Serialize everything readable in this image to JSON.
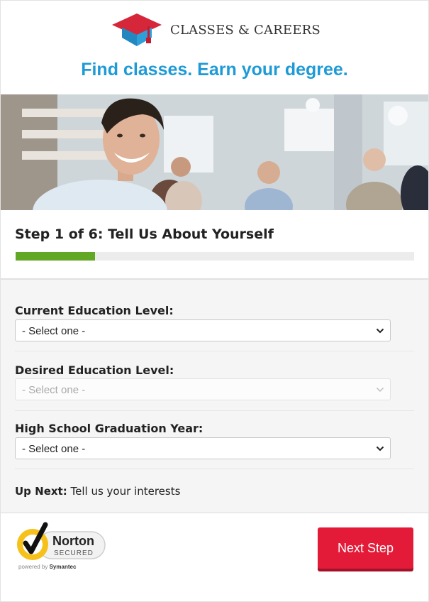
{
  "header": {
    "brand_name": "CLASSES & CAREERS",
    "tagline": "Find classes. Earn your degree."
  },
  "step": {
    "title": "Step 1 of 6: Tell Us About Yourself",
    "progress_fraction": 0.2,
    "progress_color": "#62a824"
  },
  "form": {
    "fields": [
      {
        "label": "Current Education Level:",
        "value": "- Select one -",
        "disabled": false
      },
      {
        "label": "Desired Education Level:",
        "value": "- Select one -",
        "disabled": true
      },
      {
        "label": "High School Graduation Year:",
        "value": "- Select one -",
        "disabled": false
      }
    ],
    "up_next_label": "Up Next:",
    "up_next_text": "Tell us your interests"
  },
  "footer": {
    "norton_name": "Norton",
    "norton_secured": "SECURED",
    "powered_by": "powered by",
    "symantec": "Symantec",
    "next_button": "Next Step"
  },
  "colors": {
    "accent_blue": "#1e9ad6",
    "button_red": "#e31b38",
    "logo_red": "#d6263a",
    "logo_blue": "#2f9fd8",
    "norton_yellow": "#f6c11b"
  },
  "icons": [
    "graduation-cap-logo-icon",
    "chevron-down-icon",
    "norton-checkmark-icon"
  ]
}
